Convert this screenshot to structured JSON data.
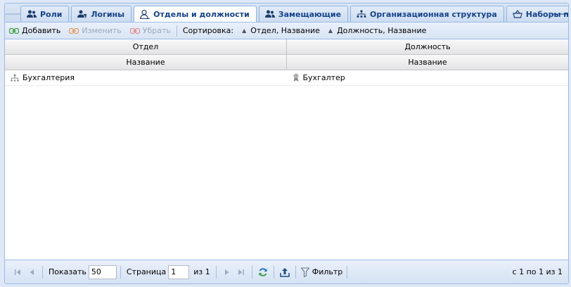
{
  "tabs": {
    "scroll_left": "🡐",
    "scroll_right": "🡒",
    "items": [
      {
        "label": "Роли",
        "icon": "users-icon"
      },
      {
        "label": "Логины",
        "icon": "user-key-icon"
      },
      {
        "label": "Отделы и должности",
        "icon": "user-card-icon",
        "active": true
      },
      {
        "label": "Замещающие",
        "icon": "users-swap-icon"
      },
      {
        "label": "Организационная структура",
        "icon": "org-structure-icon"
      },
      {
        "label": "Наборы полн",
        "icon": "basket-icon"
      }
    ]
  },
  "toolbar": {
    "add_label": "Добавить",
    "edit_label": "Изменить",
    "remove_label": "Убрать",
    "sort_label": "Сортировка:",
    "sort1": "Отдел, Название",
    "sort2": "Должность, Название"
  },
  "grid": {
    "groups": [
      "Отдел",
      "Должность"
    ],
    "columns": [
      "Название",
      "Название"
    ],
    "rows": [
      {
        "department": "Бухгалтерия",
        "position": "Бухгалтер"
      }
    ]
  },
  "pager": {
    "show_label": "Показать",
    "page_size": "50",
    "page_label": "Страница",
    "page": "1",
    "of_label": "из 1",
    "filter_label": "Фильтр",
    "info": "с 1 по 1 из 1"
  },
  "colors": {
    "accent": "#15428b",
    "border": "#99bbe8",
    "link_green": "#3a9b35",
    "link_orange": "#e69a55"
  }
}
